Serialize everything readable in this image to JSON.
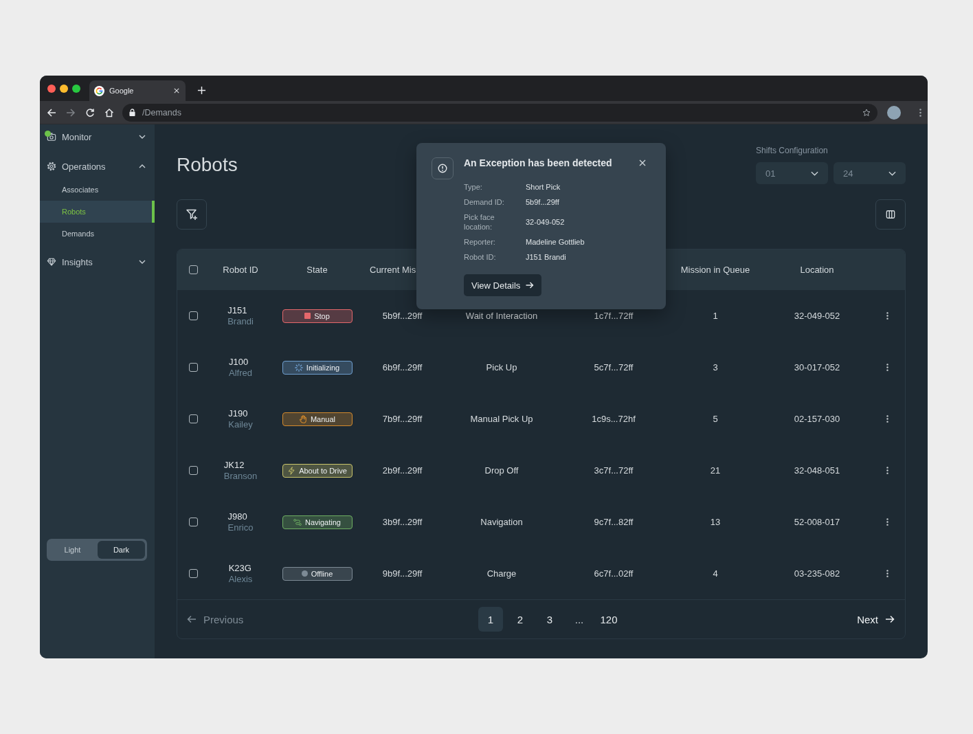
{
  "browser": {
    "tab": {
      "title": "Google"
    },
    "back": {
      "disabled": false
    },
    "forward": {
      "disabled": true
    },
    "address": "/Demands"
  },
  "sidebar": {
    "sections": [
      {
        "label": "Monitor",
        "expanded": false,
        "notification": true
      },
      {
        "label": "Operations",
        "expanded": true,
        "notification": false,
        "children": [
          {
            "label": "Associates",
            "selected": false
          },
          {
            "label": "Robots",
            "selected": true
          },
          {
            "label": "Demands",
            "selected": false
          }
        ]
      },
      {
        "label": "Insights",
        "expanded": false,
        "notification": false
      }
    ],
    "theme_toggle": [
      {
        "label": "Light",
        "selected": false
      },
      {
        "label": "Dark",
        "selected": true
      }
    ]
  },
  "page": {
    "title": "Robots",
    "shifts": {
      "label": "Shifts Configuration",
      "start": "01",
      "end": "24"
    }
  },
  "table": {
    "select_all": {
      "checked": false
    },
    "columns": [
      {
        "label": "Robot ID"
      },
      {
        "label": "State"
      },
      {
        "label": "Current Mis"
      },
      {
        "label": "Mission in Queue"
      },
      {
        "label": "Location"
      }
    ],
    "rows": [
      {
        "checked": false,
        "robot_id": "J151",
        "robot_name": "Brandi",
        "state": {
          "label": "Stop",
          "kind": "stop",
          "color": "#e5676b"
        },
        "column_3": "5b9f...29ff",
        "column_4": "Wait of Interaction",
        "column_5": "1c7f...72ff",
        "mission_in_queue": "1",
        "location": "32-049-052"
      },
      {
        "checked": false,
        "robot_id": "J100",
        "robot_name": "Alfred",
        "state": {
          "label": "Initializing",
          "kind": "initializing",
          "color": "#6f9fd0"
        },
        "column_3": "6b9f...29ff",
        "column_4": "Pick Up",
        "column_5": "5c7f...72ff",
        "mission_in_queue": "3",
        "location": "30-017-052"
      },
      {
        "checked": false,
        "robot_id": "J190",
        "robot_name": "Kailey",
        "state": {
          "label": "Manual",
          "kind": "manual",
          "color": "#d48a2c"
        },
        "column_3": "7b9f...29ff",
        "column_4": "Manual Pick Up",
        "column_5": "1c9s...72hf",
        "mission_in_queue": "5",
        "location": "02-157-030"
      },
      {
        "checked": false,
        "robot_id": "JK12",
        "robot_name": "Branson",
        "state": {
          "label": "About to Drive",
          "kind": "about_to_drive",
          "color": "#c9c46a"
        },
        "column_3": "2b9f...29ff",
        "column_4": "Drop Off",
        "column_5": "3c7f...72ff",
        "mission_in_queue": "21",
        "location": "32-048-051"
      },
      {
        "checked": false,
        "robot_id": "J980",
        "robot_name": "Enrico",
        "state": {
          "label": "Navigating",
          "kind": "navigating",
          "color": "#6fb063"
        },
        "column_3": "3b9f...29ff",
        "column_4": "Navigation",
        "column_5": "9c7f...82ff",
        "mission_in_queue": "13",
        "location": "52-008-017"
      },
      {
        "checked": false,
        "robot_id": "K23G",
        "robot_name": "Alexis",
        "state": {
          "label": "Offline",
          "kind": "offline",
          "color": "#7d8a95"
        },
        "column_3": "9b9f...29ff",
        "column_4": "Charge",
        "column_5": "6c7f...02ff",
        "mission_in_queue": "4",
        "location": "03-235-082"
      }
    ]
  },
  "pagination": {
    "previous": {
      "label": "Previous",
      "disabled": true
    },
    "pages": [
      {
        "kind": "page",
        "label": "1",
        "selected": true
      },
      {
        "kind": "page",
        "label": "2",
        "selected": false
      },
      {
        "kind": "page",
        "label": "3",
        "selected": false
      },
      {
        "kind": "ellipsis",
        "label": "...",
        "selected": false
      },
      {
        "kind": "page",
        "label": "120",
        "selected": false
      }
    ],
    "next": {
      "label": "Next",
      "disabled": false
    }
  },
  "exception_popup": {
    "title": "An Exception has been detected",
    "fields": [
      {
        "label": "Type:",
        "value": "Short Pick"
      },
      {
        "label": "Demand ID:",
        "value": "5b9f...29ff"
      },
      {
        "label": "Pick face location:",
        "value": "32-049-052"
      },
      {
        "label": "Reporter:",
        "value": "Madeline Gottlieb"
      },
      {
        "label": "Robot ID:",
        "value": "J151 Brandi"
      }
    ],
    "button": "View Details"
  }
}
